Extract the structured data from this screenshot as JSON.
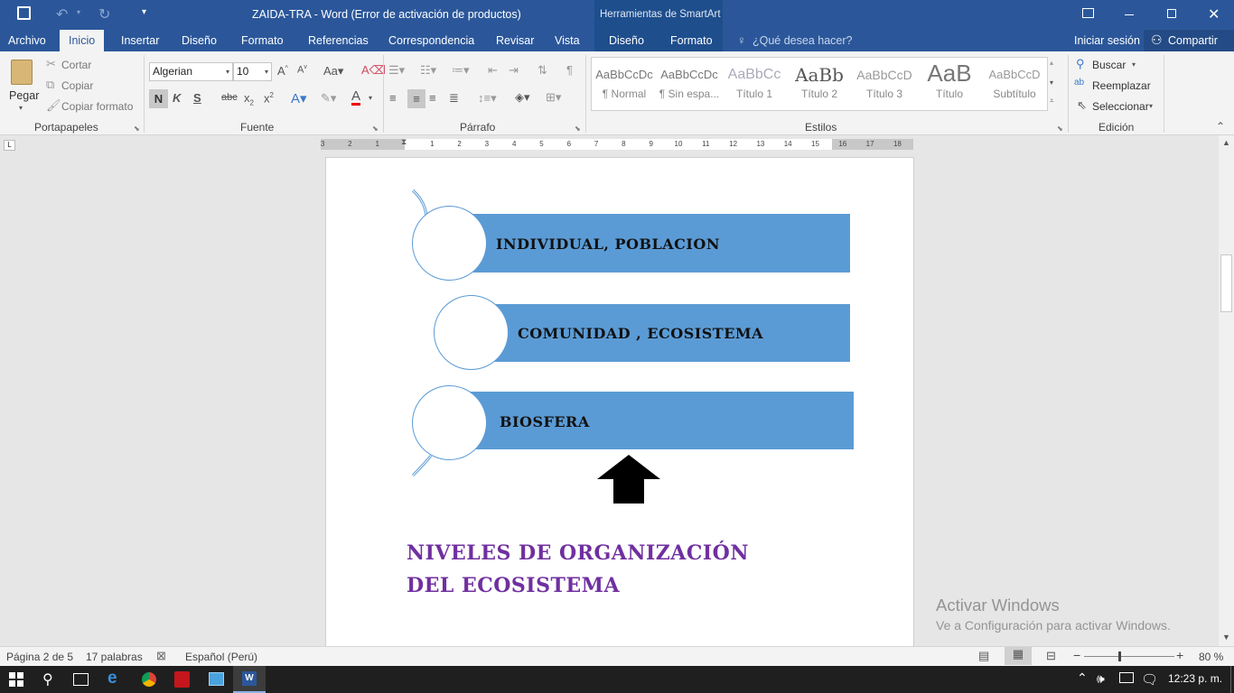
{
  "titlebar": {
    "title": "ZAIDA-TRA - Word (Error de activación de productos)",
    "context_tool": "Herramientas de SmartArt"
  },
  "tabs": [
    "Archivo",
    "Inicio",
    "Insertar",
    "Diseño",
    "Formato",
    "Referencias",
    "Correspondencia",
    "Revisar",
    "Vista",
    "Diseño",
    "Formato"
  ],
  "tellme": "¿Qué desea hacer?",
  "account": {
    "signin": "Iniciar sesión",
    "share": "Compartir"
  },
  "clipboard": {
    "paste": "Pegar",
    "cut": "Cortar",
    "copy": "Copiar",
    "format_painter": "Copiar formato",
    "label": "Portapapeles"
  },
  "font": {
    "name": "Algerian",
    "size": "10",
    "bold": "N",
    "italic": "K",
    "underline": "S",
    "label": "Fuente"
  },
  "paragraph": {
    "label": "Párrafo"
  },
  "styles": {
    "label": "Estilos",
    "items": [
      {
        "preview": "AaBbCcDc",
        "name": "¶ Normal"
      },
      {
        "preview": "AaBbCcDc",
        "name": "¶ Sin espa..."
      },
      {
        "preview": "AaBbCc",
        "name": "Título 1"
      },
      {
        "preview": "AaBb",
        "name": "Título 2"
      },
      {
        "preview": "AaBbCcD",
        "name": "Título 3"
      },
      {
        "preview": "AaB",
        "name": "Título"
      },
      {
        "preview": "AaBbCcD",
        "name": "Subtítulo"
      }
    ]
  },
  "editing": {
    "find": "Buscar",
    "replace": "Reemplazar",
    "select": "Seleccionar",
    "label": "Edición"
  },
  "ruler": {
    "numbers": [
      "3",
      "2",
      "1",
      "1",
      "2",
      "3",
      "4",
      "5",
      "6",
      "7",
      "8",
      "9",
      "10",
      "11",
      "12",
      "13",
      "14",
      "15",
      "16",
      "17",
      "18"
    ]
  },
  "smartart": {
    "items": [
      "INDIVIDUAL, POBLACION",
      "COMUNIDAD , ECOSISTEMA",
      "BIOSFERA"
    ],
    "color": "#5b9bd5"
  },
  "document": {
    "heading": "NIVELES DE ORGANIZACIÓN DEL ECOSISTEMA",
    "heading_color": "#7030a0"
  },
  "watermark": {
    "line1": "Activar Windows",
    "line2": "Ve a Configuración para activar Windows."
  },
  "status": {
    "page": "Página 2 de 5",
    "words": "17 palabras",
    "language": "Español (Perú)",
    "zoom": "80 %"
  },
  "taskbar": {
    "time": "12:23 p. m."
  }
}
